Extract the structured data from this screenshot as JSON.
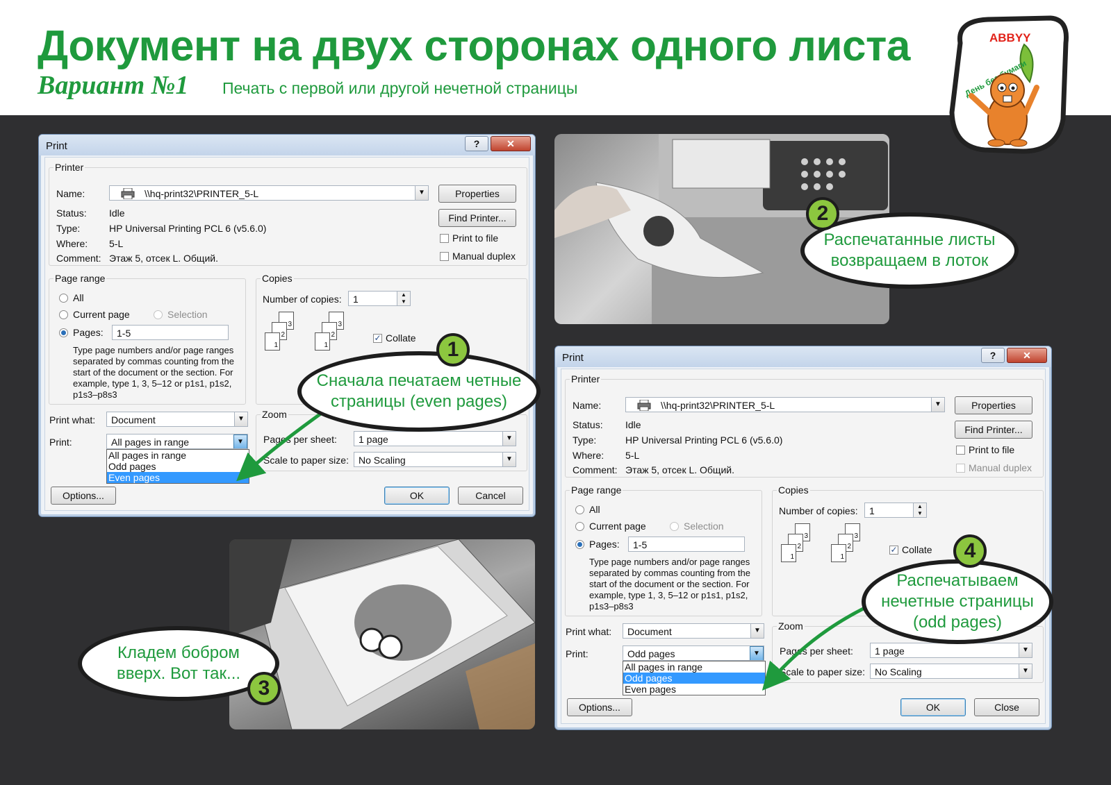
{
  "header": {
    "title": "Документ на двух сторонах одного листа",
    "variant": "Вариант №1",
    "subtitle": "Печать с первой или другой нечетной страницы"
  },
  "logo": {
    "brand": "ABBYY",
    "tagline": "День без бумаги"
  },
  "callouts": {
    "step1": {
      "num": "1",
      "text": "Сначала печатаем четные страницы (even pages)"
    },
    "step2": {
      "num": "2",
      "text": "Распечатанные листы возвращаем в лоток"
    },
    "step3": {
      "num": "3",
      "text": "Кладем бобром вверх. Вот так..."
    },
    "step4": {
      "num": "4",
      "text": "Распечатываем нечетные страницы (odd pages)"
    }
  },
  "dialog1": {
    "title": "Print",
    "help": "?",
    "close": "✕",
    "printer_group": "Printer",
    "name_label": "Name:",
    "name_value": "\\\\hq-print32\\PRINTER_5-L",
    "status_label": "Status:",
    "status_value": "Idle",
    "type_label": "Type:",
    "type_value": "HP Universal Printing PCL 6 (v5.6.0)",
    "where_label": "Where:",
    "where_value": "5-L",
    "comment_label": "Comment:",
    "comment_value": "Этаж 5, отсек L. Общий.",
    "properties": "Properties",
    "find_printer": "Find Printer...",
    "print_to_file": "Print to file",
    "manual_duplex": "Manual duplex",
    "page_range": "Page range",
    "all": "All",
    "current_page": "Current page",
    "selection": "Selection",
    "pages_label": "Pages:",
    "pages_value": "1-5",
    "hint": "Type page numbers and/or page ranges separated by commas counting from the start of the document or the section. For example, type 1, 3, 5–12 or p1s1, p1s2, p1s3–p8s3",
    "copies": "Copies",
    "num_copies_label": "Number of copies:",
    "num_copies_value": "1",
    "collate": "Collate",
    "print_what_label": "Print what:",
    "print_what_value": "Document",
    "print_label": "Print:",
    "print_value": "All pages in range",
    "print_options": [
      "All pages in range",
      "Odd pages",
      "Even pages"
    ],
    "zoom": "Zoom",
    "pages_per_sheet_label": "Pages per sheet:",
    "pages_per_sheet_value": "1 page",
    "scale_label": "Scale to paper size:",
    "scale_value": "No Scaling",
    "options": "Options...",
    "ok": "OK",
    "cancel": "Cancel"
  },
  "dialog2": {
    "title": "Print",
    "help": "?",
    "close": "✕",
    "printer_group": "Printer",
    "name_label": "Name:",
    "name_value": "\\\\hq-print32\\PRINTER_5-L",
    "status_label": "Status:",
    "status_value": "Idle",
    "type_label": "Type:",
    "type_value": "HP Universal Printing PCL 6 (v5.6.0)",
    "where_label": "Where:",
    "where_value": "5-L",
    "comment_label": "Comment:",
    "comment_value": "Этаж 5, отсек L. Общий.",
    "properties": "Properties",
    "find_printer": "Find Printer...",
    "print_to_file": "Print to file",
    "manual_duplex": "Manual duplex",
    "page_range": "Page range",
    "all": "All",
    "current_page": "Current page",
    "selection": "Selection",
    "pages_label": "Pages:",
    "pages_value": "1-5",
    "hint": "Type page numbers and/or page ranges separated by commas counting from the start of the document or the section. For example, type 1, 3, 5–12 or p1s1, p1s2, p1s3–p8s3",
    "copies": "Copies",
    "num_copies_label": "Number of copies:",
    "num_copies_value": "1",
    "collate": "Collate",
    "print_what_label": "Print what:",
    "print_what_value": "Document",
    "print_label": "Print:",
    "print_value": "Odd pages",
    "print_options": [
      "All pages in range",
      "Odd pages",
      "Even pages"
    ],
    "zoom": "Zoom",
    "pages_per_sheet_label": "Pages per sheet:",
    "pages_per_sheet_value": "1 page",
    "scale_label": "Scale to paper size:",
    "scale_value": "No Scaling",
    "options": "Options...",
    "ok": "OK",
    "close_btn": "Close"
  },
  "colors": {
    "brand_green": "#1f9a3d",
    "badge_green": "#8cc63f",
    "background": "#2f2f31"
  }
}
